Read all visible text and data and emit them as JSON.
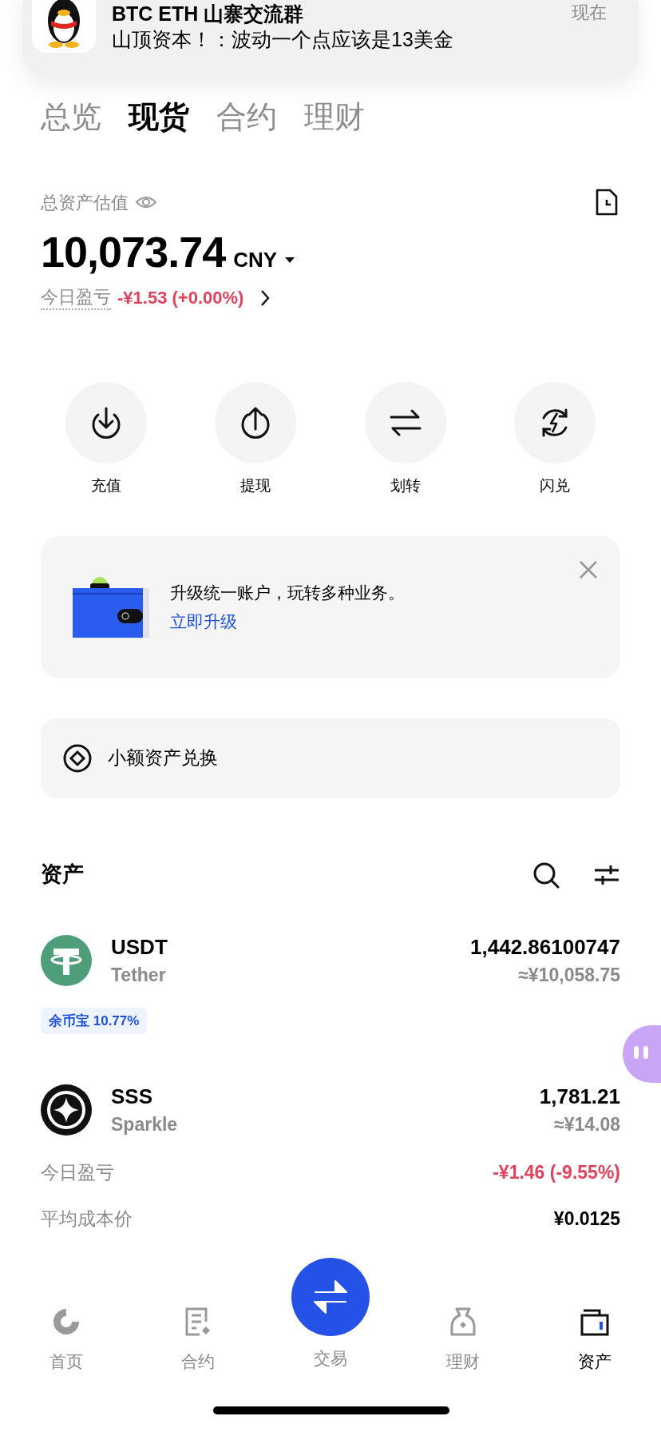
{
  "notification": {
    "title": "BTC ETH 山寨交流群",
    "message": "山顶资本！：波动一个点应该是13美金",
    "time": "现在"
  },
  "tabs": [
    {
      "label": "总览",
      "selected": false
    },
    {
      "label": "现货",
      "selected": true
    },
    {
      "label": "合约",
      "selected": false
    },
    {
      "label": "理财",
      "selected": false
    }
  ],
  "summary": {
    "label": "总资产估值",
    "value": "10,073.74",
    "currency": "CNY",
    "pnl_label": "今日盈亏",
    "pnl_value": "-¥1.53 (+0.00%)"
  },
  "actions": [
    {
      "label": "充值"
    },
    {
      "label": "提现"
    },
    {
      "label": "划转"
    },
    {
      "label": "闪兑"
    }
  ],
  "upgrade_card": {
    "text": "升级统一账户，玩转多种业务。",
    "link": "立即升级"
  },
  "small_assets": {
    "label": "小额资产兑换"
  },
  "assets": {
    "title": "资产",
    "rows": [
      {
        "symbol": "USDT",
        "name": "Tether",
        "amount": "1,442.86100747",
        "value": "≈¥10,058.75",
        "badge": "余币宝 10.77%"
      },
      {
        "symbol": "SSS",
        "name": "Sparkle",
        "amount": "1,781.21",
        "value": "≈¥14.08",
        "details": [
          {
            "label": "今日盈亏",
            "value": "-¥1.46 (-9.55%)",
            "kind": "loss"
          },
          {
            "label": "平均成本价",
            "value": "¥0.0125",
            "kind": "plain"
          }
        ]
      }
    ]
  },
  "nav": [
    {
      "label": "首页",
      "selected": false,
      "kind": "tab"
    },
    {
      "label": "合约",
      "selected": false,
      "kind": "tab"
    },
    {
      "label": "交易",
      "selected": false,
      "kind": "center"
    },
    {
      "label": "理财",
      "selected": false,
      "kind": "tab"
    },
    {
      "label": "资产",
      "selected": true,
      "kind": "tab"
    }
  ]
}
